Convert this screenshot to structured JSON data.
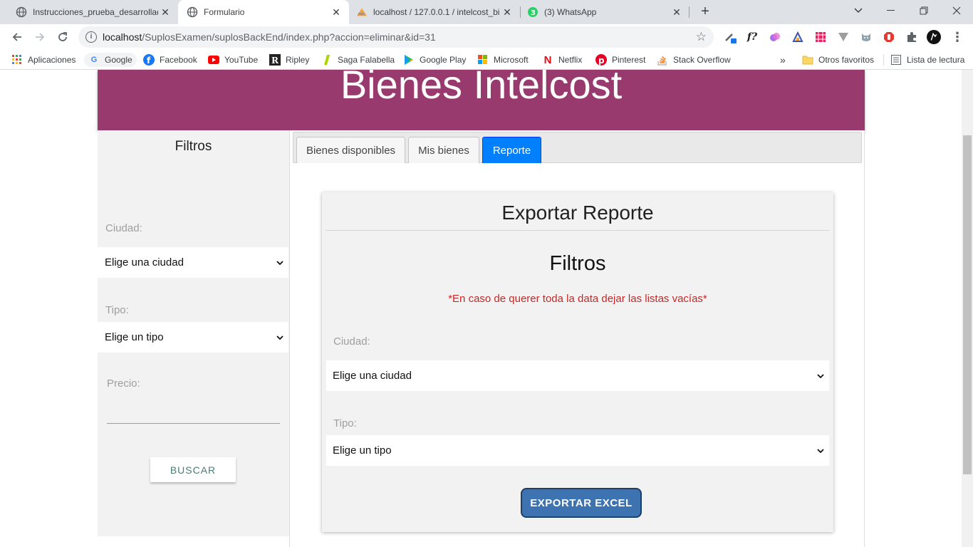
{
  "browser": {
    "tabs": [
      {
        "title": "Instrucciones_prueba_desarrollad",
        "icon": "globe-icon",
        "active": false
      },
      {
        "title": "Formulario",
        "icon": "globe-icon",
        "active": true
      },
      {
        "title": "localhost / 127.0.0.1 / intelcost_bi",
        "icon": "phpmyadmin-icon",
        "active": false
      },
      {
        "title": "(3) WhatsApp",
        "icon": "whatsapp-icon",
        "active": false
      }
    ],
    "url_host": "localhost",
    "url_path": "/SuplosExamen/suplosBackEnd/index.php?accion=eliminar&id=31",
    "bookmarks": [
      {
        "label": "Aplicaciones",
        "icon": "apps-grid-icon"
      },
      {
        "label": "Google",
        "icon": "google-icon"
      },
      {
        "label": "Facebook",
        "icon": "facebook-icon"
      },
      {
        "label": "YouTube",
        "icon": "youtube-icon"
      },
      {
        "label": "Ripley",
        "icon": "ripley-icon"
      },
      {
        "label": "Saga Falabella",
        "icon": "falabella-icon"
      },
      {
        "label": "Google Play",
        "icon": "google-play-icon"
      },
      {
        "label": "Microsoft",
        "icon": "microsoft-icon"
      },
      {
        "label": "Netflix",
        "icon": "netflix-icon"
      },
      {
        "label": "Pinterest",
        "icon": "pinterest-icon"
      },
      {
        "label": "Stack Overflow",
        "icon": "stackoverflow-icon"
      }
    ],
    "bookmarks_overflow": "»",
    "other_favorites": "Otros favoritos",
    "reading_list": "Lista de lectura"
  },
  "page": {
    "header_title": "Bienes Intelcost",
    "sidebar": {
      "title": "Filtros",
      "city_label": "Ciudad:",
      "city_value": "Elige una ciudad",
      "type_label": "Tipo:",
      "type_value": "Elige un tipo",
      "price_label": "Precio:",
      "search_button": "BUSCAR"
    },
    "tabs": [
      "Bienes disponibles",
      "Mis bienes",
      "Reporte"
    ],
    "active_tab": "Reporte",
    "report": {
      "title": "Exportar Reporte",
      "filters_title": "Filtros",
      "note": "*En caso de querer toda la data dejar las listas vacías*",
      "city_label": "Ciudad:",
      "city_value": "Elige una ciudad",
      "type_label": "Tipo:",
      "type_value": "Elige un tipo",
      "export_button": "EXPORTAR EXCEL"
    }
  },
  "colors": {
    "header": "#993a6e",
    "active_tab": "#007fff",
    "export_button": "#3c73b0",
    "warning_text": "#c62828"
  }
}
